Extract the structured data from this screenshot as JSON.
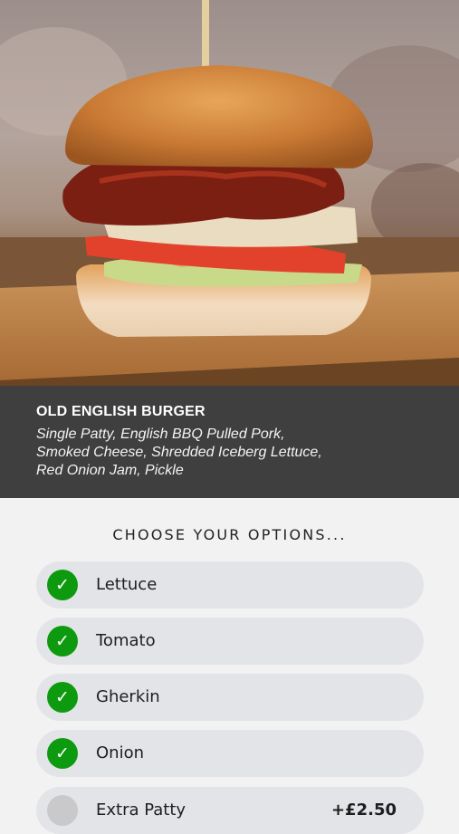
{
  "product": {
    "title": "OLD ENGLISH BURGER",
    "description": "Single Patty, English BBQ Pulled Pork, Smoked Cheese, Shredded Iceberg Lettuce, Red Onion Jam, Pickle"
  },
  "options": {
    "heading": "CHOOSE YOUR OPTIONS...",
    "items": [
      {
        "label": "Lettuce",
        "checked": true,
        "price": "",
        "check_glyph": "✓"
      },
      {
        "label": "Tomato",
        "checked": true,
        "price": "",
        "check_glyph": "✓"
      },
      {
        "label": "Gherkin",
        "checked": true,
        "price": "",
        "check_glyph": "✓"
      },
      {
        "label": "Onion",
        "checked": true,
        "price": "",
        "check_glyph": "✓"
      },
      {
        "label": "Extra Patty",
        "checked": false,
        "price": "+£2.50",
        "check_glyph": ""
      }
    ]
  },
  "colors": {
    "check_green": "#0e9a0e",
    "info_panel_bg": "#3f3f3f",
    "option_pill_bg": "#e3e4e7"
  }
}
